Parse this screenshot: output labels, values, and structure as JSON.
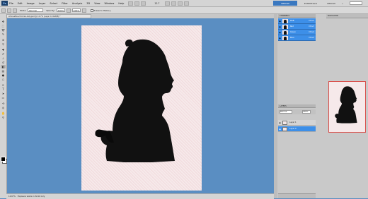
{
  "app": {
    "logo": "Ps",
    "menu": [
      "File",
      "Edit",
      "Image",
      "Layer",
      "Select",
      "Filter",
      "Analysis",
      "3D",
      "View",
      "Window",
      "Help"
    ],
    "zoom": "12.7",
    "workspaces": [
      "DESIGN",
      "ESSENTIALS",
      "DESIGN",
      "»"
    ]
  },
  "options": {
    "mode_label": "Mode:",
    "mode_value": "Normal",
    "opacity_label": "Opacity:",
    "opacity_value": "100%",
    "flow_value": "100%",
    "erase_label": "Erase to History"
  },
  "document": {
    "tab_title": "silhouette-victorian-lady.psd @ 12.7% (Layer 0, RGB/8) *",
    "canvas_bg": "#f6e9ea",
    "silhouette_color": "#111111"
  },
  "status": {
    "zoom": "12.67%",
    "info": "Exposure works in 32-bit only"
  },
  "channels": {
    "title": "CHANNELS",
    "rows": [
      {
        "name": "RGB",
        "shortcut": "Ctrl+2"
      },
      {
        "name": "Red",
        "shortcut": "Ctrl+3"
      },
      {
        "name": "Green",
        "shortcut": "Ctrl+4"
      },
      {
        "name": "Blue",
        "shortcut": "Ctrl+5"
      }
    ]
  },
  "layers": {
    "title": "LAYERS",
    "blend": "Normal",
    "opacity": "100%",
    "rows": [
      {
        "name": "Layer 1"
      },
      {
        "name": "Layer 0"
      }
    ]
  },
  "navigator": {
    "title": "NAVIGATOR"
  },
  "tools": [
    "move",
    "marquee",
    "lasso",
    "quick-select",
    "crop",
    "eyedropper",
    "healing",
    "brush",
    "clone",
    "history-brush",
    "eraser",
    "gradient",
    "blur",
    "dodge",
    "pen",
    "type",
    "path-select",
    "shape",
    "hand",
    "zoom",
    "3d-rotate",
    "3d-orbit"
  ],
  "colors": {
    "accent": "#3a78c0",
    "workspace_bg": "#5a8ec2",
    "selection_blue": "#3d8fe8"
  }
}
